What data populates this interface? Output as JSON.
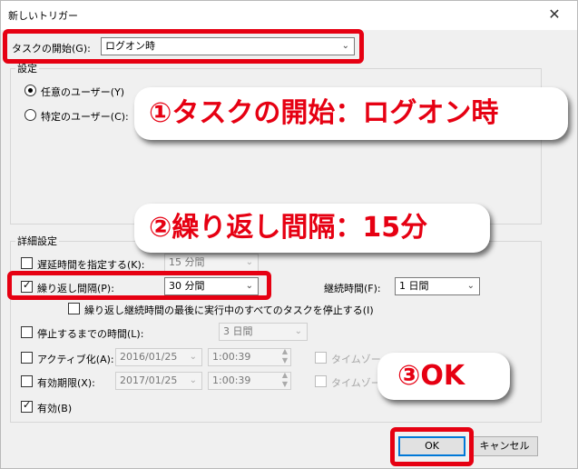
{
  "window": {
    "title": "新しいトリガー",
    "close_glyph": "✕"
  },
  "start_task": {
    "label": "タスクの開始(G):",
    "value": "ログオン時"
  },
  "settings": {
    "group_label": "設定",
    "any_user": "任意のユーザー(Y)",
    "specific_user": "特定のユーザー(C):"
  },
  "advanced": {
    "group_label": "詳細設定",
    "delay_label": "遅延時間を指定する(K):",
    "delay_value": "15 分間",
    "repeat_label": "繰り返し間隔(P):",
    "repeat_value": "30 分間",
    "duration_label": "継続時間(F):",
    "duration_value": "1 日間",
    "stop_running_label": "繰り返し継続時間の最後に実行中のすべてのタスクを停止する(I)",
    "stop_after_label": "停止するまでの時間(L):",
    "stop_after_value": "3 日間",
    "activate_label": "アクティブ化(A):",
    "activate_date": "2016/01/25",
    "activate_time": "1:00:39",
    "timezone_label": "タイムゾー",
    "expire_label": "有効期限(X):",
    "expire_date": "2017/01/25",
    "expire_time": "1:00:39",
    "enabled_label": "有効(B)"
  },
  "buttons": {
    "ok": "OK",
    "cancel": "キャンセル"
  },
  "callouts": {
    "c1": "①タスクの開始：ログオン時",
    "c2": "②繰り返し間隔：15分",
    "c3": "③OK"
  },
  "colors": {
    "highlight": "#e60012",
    "focus": "#0078d7"
  }
}
